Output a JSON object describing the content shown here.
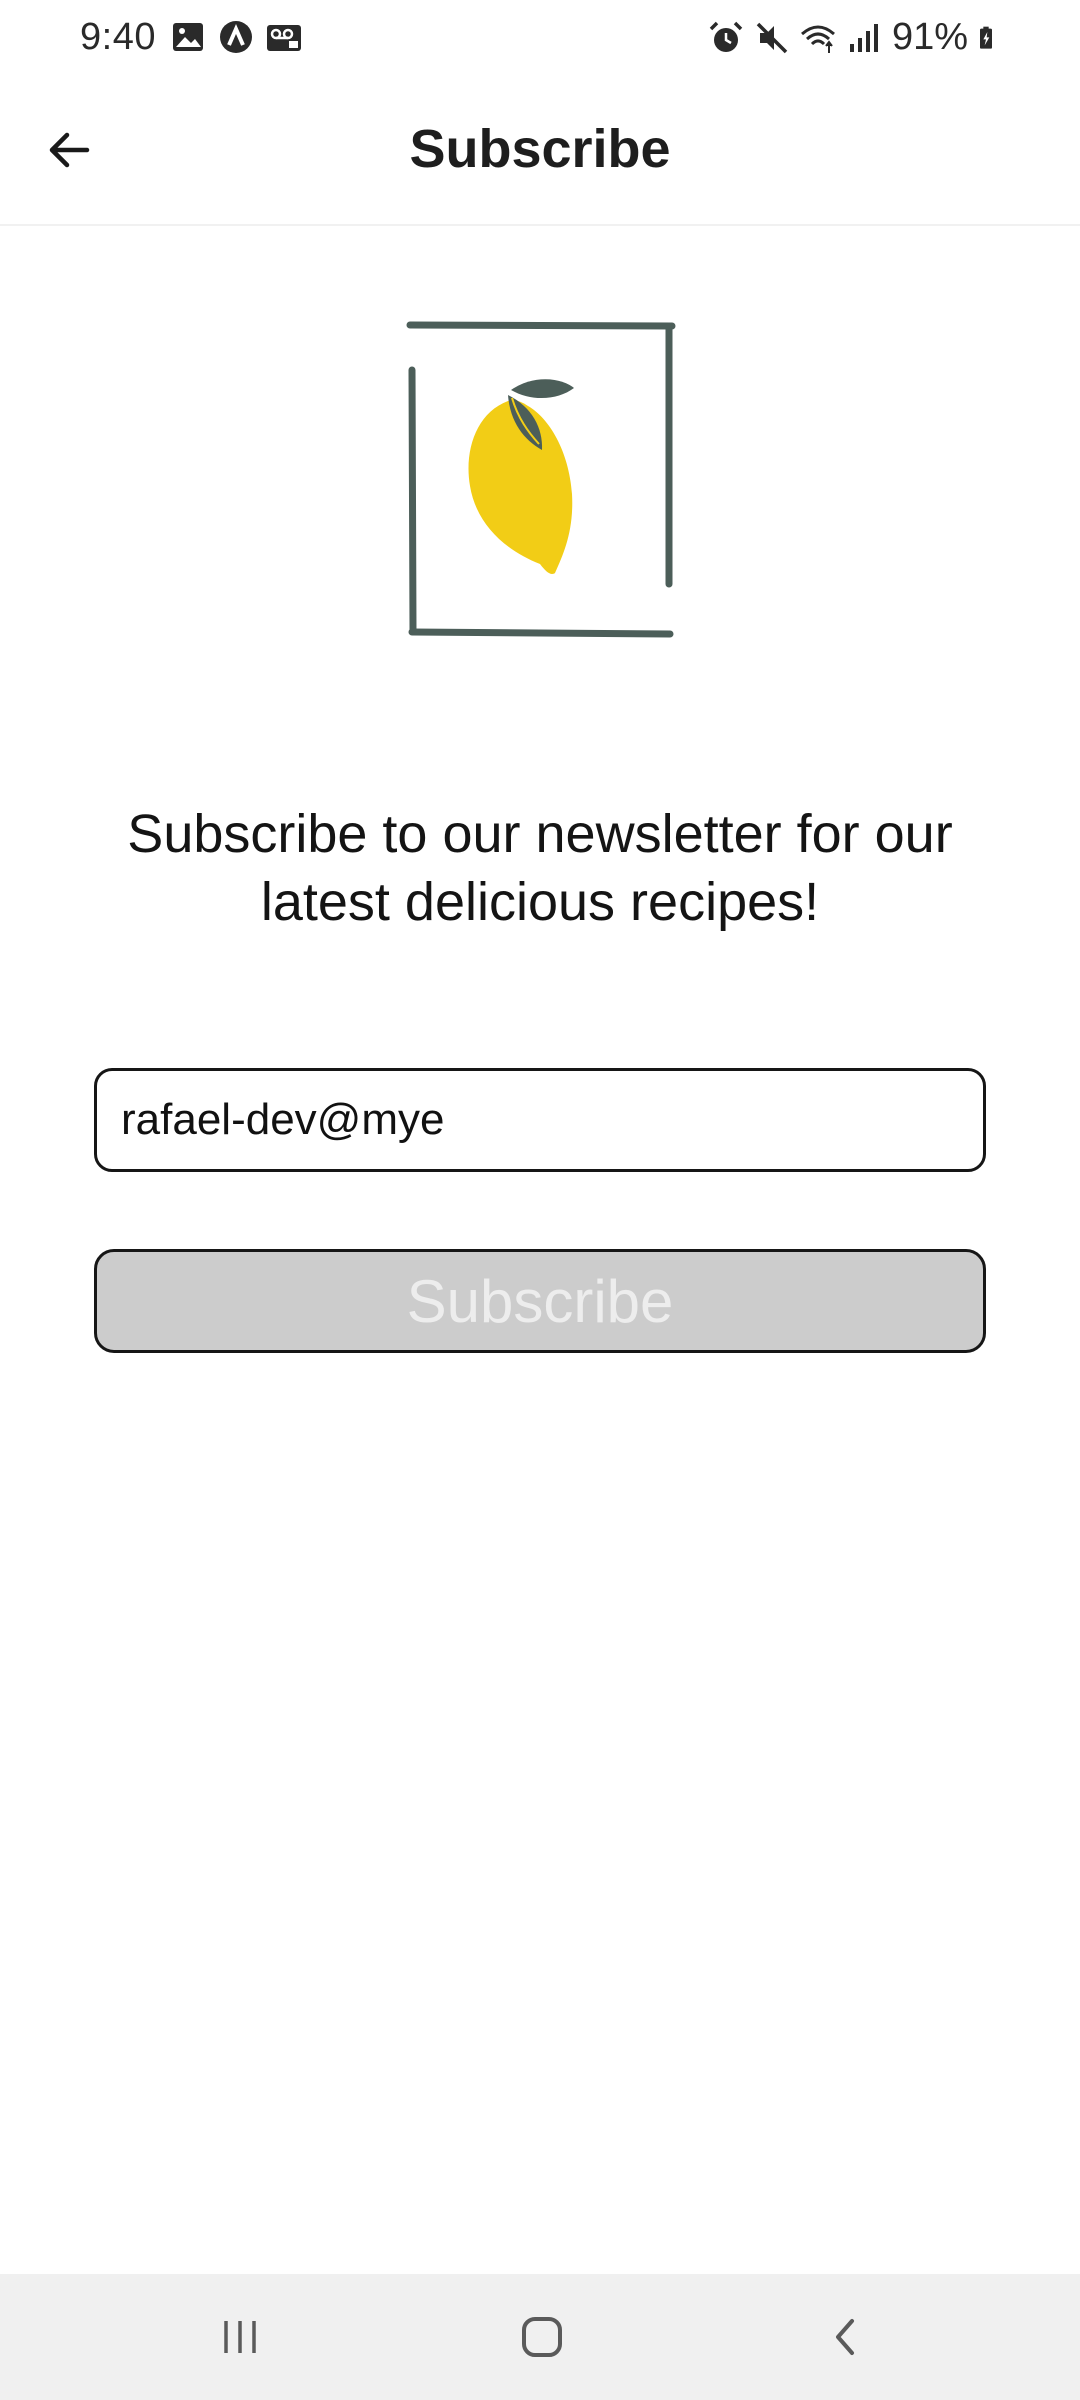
{
  "status_bar": {
    "time": "9:40",
    "battery_percent": "91%",
    "left_icons": [
      "image-icon",
      "app-a-icon",
      "voicemail-icon"
    ],
    "right_icons": [
      "alarm-icon",
      "mute-icon",
      "wifi-icon",
      "signal-icon",
      "battery-charging-icon"
    ]
  },
  "app_bar": {
    "title": "Subscribe",
    "back_icon": "arrow-left-icon"
  },
  "illustration": {
    "name": "lemon-logo",
    "colors": {
      "frame": "#4c5e59",
      "lemon": "#f2cd16",
      "leaf": "#4c5e59"
    }
  },
  "content": {
    "headline": "Subscribe to our newsletter for our latest delicious recipes!",
    "email_value": "rafael-dev@mye",
    "subscribe_label": "Subscribe",
    "subscribe_enabled": false
  },
  "nav_bar": {
    "items": [
      "recent-apps-icon",
      "home-icon",
      "back-icon"
    ]
  },
  "colors": {
    "button_disabled_bg": "#cccccc",
    "button_disabled_text": "#ededed",
    "border": "#161616",
    "nav_bg": "#f0f0f0"
  }
}
